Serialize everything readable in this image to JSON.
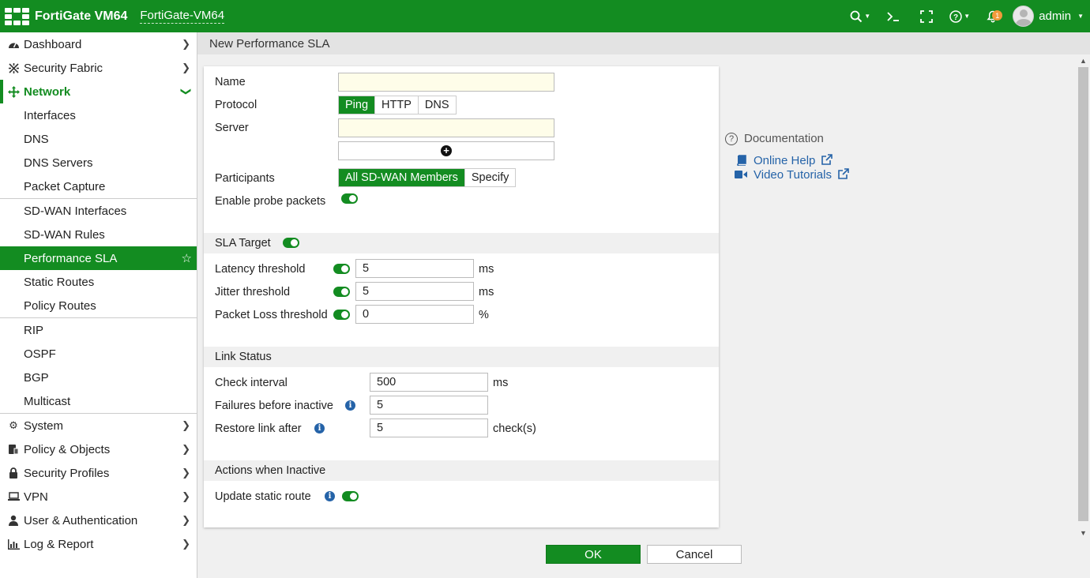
{
  "header": {
    "brand": "FortiGate VM64",
    "hostname": "FortiGate-VM64",
    "notification_count": "1",
    "user": "admin"
  },
  "sidebar": {
    "items": [
      {
        "label": "Dashboard",
        "icon": "dashboard-icon"
      },
      {
        "label": "Security Fabric",
        "icon": "security-fabric-icon"
      },
      {
        "label": "Network",
        "icon": "network-icon"
      },
      {
        "label": "Interfaces"
      },
      {
        "label": "DNS"
      },
      {
        "label": "DNS Servers"
      },
      {
        "label": "Packet Capture"
      },
      {
        "label": "SD-WAN Interfaces"
      },
      {
        "label": "SD-WAN Rules"
      },
      {
        "label": "Performance SLA"
      },
      {
        "label": "Static Routes"
      },
      {
        "label": "Policy Routes"
      },
      {
        "label": "RIP"
      },
      {
        "label": "OSPF"
      },
      {
        "label": "BGP"
      },
      {
        "label": "Multicast"
      },
      {
        "label": "System",
        "icon": "gear-icon"
      },
      {
        "label": "Policy & Objects",
        "icon": "policy-icon"
      },
      {
        "label": "Security Profiles",
        "icon": "lock-icon"
      },
      {
        "label": "VPN",
        "icon": "laptop-icon"
      },
      {
        "label": "User & Authentication",
        "icon": "user-icon"
      },
      {
        "label": "Log & Report",
        "icon": "bar-chart-icon"
      }
    ]
  },
  "page": {
    "title": "New Performance SLA"
  },
  "form": {
    "name_label": "Name",
    "name_value": "",
    "protocol_label": "Protocol",
    "protocol_options": [
      "Ping",
      "HTTP",
      "DNS"
    ],
    "server_label": "Server",
    "server_value": "",
    "participants_label": "Participants",
    "participants_options": [
      "All SD-WAN Members",
      "Specify"
    ],
    "probe_label": "Enable probe packets",
    "sla_target_label": "SLA Target",
    "latency_label": "Latency threshold",
    "latency_value": "5",
    "latency_unit": "ms",
    "jitter_label": "Jitter threshold",
    "jitter_value": "5",
    "jitter_unit": "ms",
    "packet_loss_label": "Packet Loss threshold",
    "packet_loss_value": "0",
    "packet_loss_unit": "%",
    "link_status_label": "Link Status",
    "check_interval_label": "Check interval",
    "check_interval_value": "500",
    "check_interval_unit": "ms",
    "failures_label": "Failures before inactive",
    "failures_value": "5",
    "restore_label": "Restore link after",
    "restore_value": "5",
    "restore_unit": "check(s)",
    "actions_label": "Actions when Inactive",
    "update_route_label": "Update static route"
  },
  "docs": {
    "title": "Documentation",
    "links": [
      "Online Help",
      "Video Tutorials"
    ]
  },
  "footer": {
    "ok": "OK",
    "cancel": "Cancel"
  },
  "colors": {
    "accent": "#138c21",
    "link": "#2563a8"
  }
}
